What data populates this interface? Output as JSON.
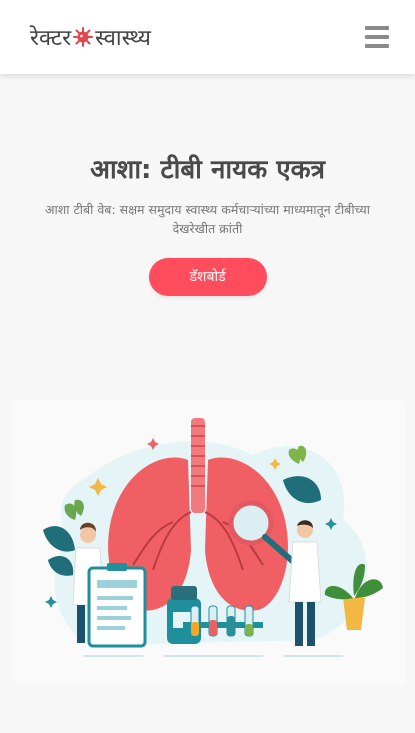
{
  "header": {
    "logo_left": "रेक्टर",
    "logo_right": "स्वास्थ्य",
    "virus_icon": "virus-icon",
    "menu_icon": "hamburger-menu-icon"
  },
  "hero": {
    "title": "आशा: टीबी नायक एकत्र",
    "subtitle": "आशा टीबी वेब: सक्षम समुदाय स्वास्थ्य कर्मचाऱ्यांच्या माध्यमातून टीबीच्या देखरेखीत क्रांती",
    "button_label": "डॅशबोर्ड"
  },
  "colors": {
    "accent": "#ff4d5e",
    "lung": "#ef5f63",
    "teal": "#1f8f9c"
  }
}
